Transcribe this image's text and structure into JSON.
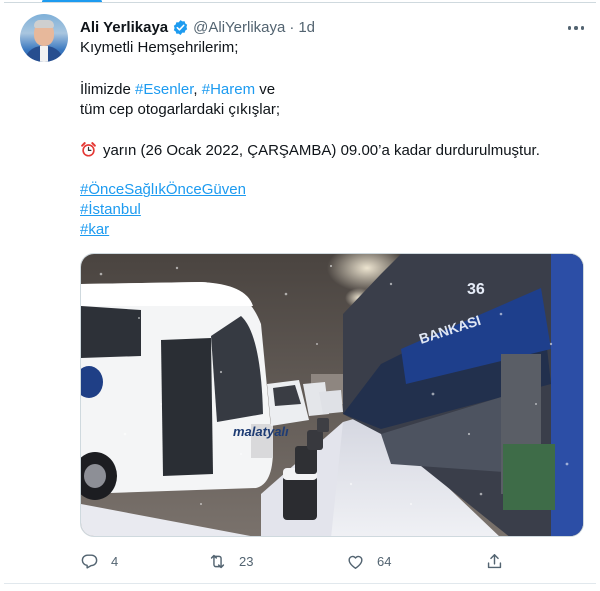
{
  "tweet": {
    "author_name": "Ali Yerlikaya",
    "handle": "@AliYerlikaya",
    "separator": "·",
    "time": "1d",
    "lines": {
      "greeting": "Kıymetli Hemşehrilerim;",
      "l2_prefix": "İlimizde ",
      "tag_esenler": "#Esenler",
      "l2_comma": ", ",
      "tag_harem": "#Harem",
      "l2_suffix": " ve",
      "l3": "tüm cep otogarlardaki çıkışlar;",
      "l4": "yarın (26 Ocak 2022, ÇARŞAMBA) 09.00’a kadar durdurulmuştur.",
      "tag1": "#ÖnceSağlıkÖnceGüven",
      "tag2": "#İstanbul",
      "tag3": "#kar"
    },
    "photo_text": {
      "bus_brand": "malatyalı",
      "platform_number": "36",
      "bank_sign": "BANKASI"
    },
    "stats": {
      "replies": "4",
      "retweets": "23",
      "likes": "64"
    }
  },
  "colors": {
    "link": "#1d9bf0",
    "secondary_text": "#536471",
    "verified_badge": "#1d9bf0"
  },
  "icons": [
    "verified-badge-icon",
    "more-icon",
    "alarm-clock-icon",
    "reply-icon",
    "retweet-icon",
    "like-icon",
    "share-icon"
  ]
}
